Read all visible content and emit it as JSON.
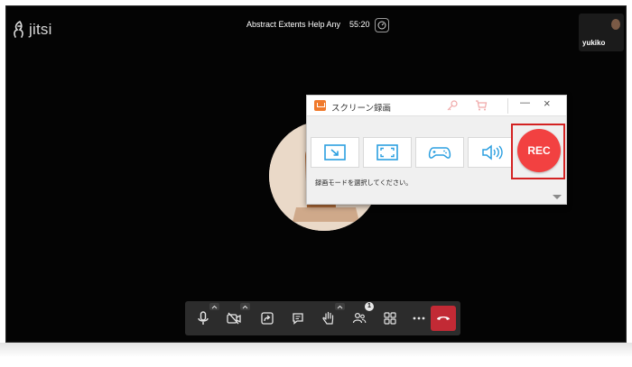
{
  "window": {
    "meeting_title": "Abstract Extents Help Any",
    "timer": "55:20",
    "logo_text": "jitsi"
  },
  "participant_thumbnail": {
    "name": "yukiko"
  },
  "toolbar": {
    "buttons": [
      {
        "name": "microphone",
        "icon": "microphone-icon",
        "has_caret": true
      },
      {
        "name": "camera",
        "icon": "camera-off-icon",
        "has_caret": true
      },
      {
        "name": "share-screen",
        "icon": "share-screen-icon"
      },
      {
        "name": "chat",
        "icon": "chat-icon"
      },
      {
        "name": "raise-hand",
        "icon": "hand-icon",
        "has_caret": true
      },
      {
        "name": "participants",
        "icon": "participants-icon",
        "badge": "1"
      },
      {
        "name": "tile-view",
        "icon": "grid-icon"
      },
      {
        "name": "more",
        "icon": "more-icon"
      },
      {
        "name": "leave",
        "icon": "hangup-icon"
      }
    ],
    "participants_badge": "1",
    "hangup_color": "#c22a35"
  },
  "recorder": {
    "title": "スクリーン録画",
    "rec_label": "REC",
    "hint": "録画モードを選択してください。",
    "modes": [
      {
        "name": "region",
        "icon": "region-capture-icon"
      },
      {
        "name": "fullscreen",
        "icon": "fullscreen-icon"
      },
      {
        "name": "game",
        "icon": "gamepad-icon"
      },
      {
        "name": "audio",
        "icon": "speaker-icon"
      }
    ],
    "accent_color": "#f24141",
    "highlight_color": "#d32222",
    "icon_color": "#2b9fe0"
  }
}
